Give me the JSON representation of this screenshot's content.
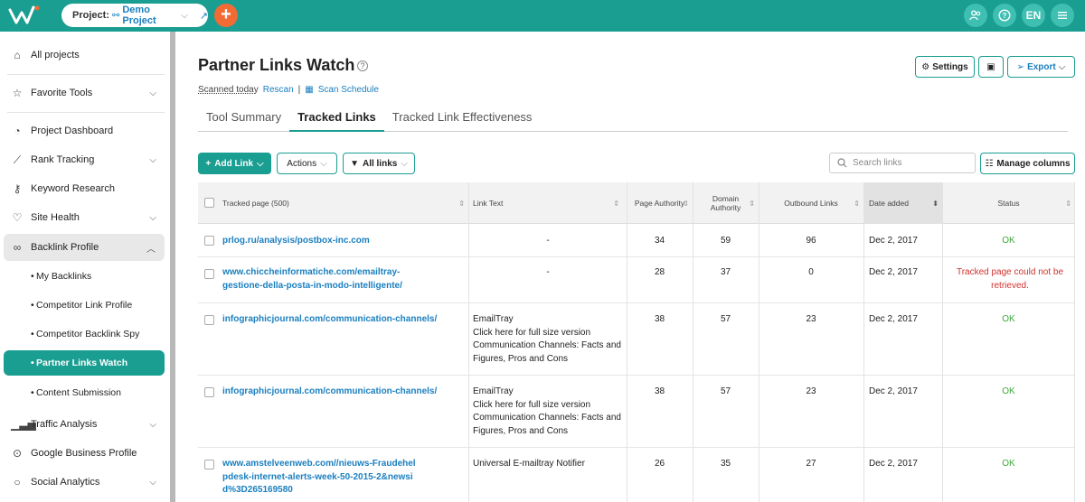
{
  "topbar": {
    "project_label": "Project:",
    "project_name": "Demo Project",
    "lang": "EN"
  },
  "sidebar": {
    "items": [
      {
        "label": "All projects",
        "icon": "home-icon"
      },
      {
        "label": "Favorite Tools",
        "icon": "star-icon"
      },
      {
        "label": "Project Dashboard",
        "icon": "dashboard-icon"
      },
      {
        "label": "Rank Tracking",
        "icon": "chart-line-icon"
      },
      {
        "label": "Keyword Research",
        "icon": "key-icon"
      },
      {
        "label": "Site Health",
        "icon": "heart-icon"
      },
      {
        "label": "Backlink Profile",
        "icon": "link-icon"
      },
      {
        "label": "Traffic Analysis",
        "icon": "bar-chart-icon"
      },
      {
        "label": "Google Business Profile",
        "icon": "location-pin-icon"
      },
      {
        "label": "Social Analytics",
        "icon": "chat-bubble-icon"
      }
    ],
    "sub_items": [
      {
        "label": "My Backlinks"
      },
      {
        "label": "Competitor Link Profile"
      },
      {
        "label": "Competitor Backlink Spy"
      },
      {
        "label": "Partner Links Watch"
      },
      {
        "label": "Content Submission"
      }
    ]
  },
  "page": {
    "title": "Partner Links Watch",
    "scanned": "Scanned today",
    "rescan": "Rescan",
    "separator": "|",
    "scan_schedule": "Scan Schedule",
    "settings": "Settings",
    "export": "Export"
  },
  "tabs": [
    {
      "label": "Tool Summary"
    },
    {
      "label": "Tracked Links"
    },
    {
      "label": "Tracked Link Effectiveness"
    }
  ],
  "toolbar": {
    "add_link": "Add Link",
    "actions": "Actions",
    "all_links": "All links",
    "search_placeholder": "Search links",
    "manage_columns": "Manage columns"
  },
  "table": {
    "headers": {
      "tracked_page": "Tracked page (500)",
      "link_text": "Link Text",
      "page_authority": "Page Authority",
      "domain_authority": "Domain Authority",
      "outbound_links": "Outbound Links",
      "date_added": "Date added",
      "status": "Status"
    },
    "rows": [
      {
        "page": "prlog.ru/analysis/postbox-inc.com",
        "link_text": "-",
        "pa": "34",
        "da": "59",
        "out": "96",
        "date": "Dec 2, 2017",
        "status": "OK",
        "status_type": "ok"
      },
      {
        "page": "www.chiccheinformatiche.com/emailtray-gestione-della-posta-in-modo-intelligente/",
        "link_text": "-",
        "pa": "28",
        "da": "37",
        "out": "0",
        "date": "Dec 2, 2017",
        "status": "Tracked page could not be retrieved.",
        "status_type": "err"
      },
      {
        "page": "infographicjournal.com/communication-channels/",
        "link_text": "EmailTray\nClick here for full size version\nCommunication Channels: Facts and Figures, Pros and Cons",
        "pa": "38",
        "da": "57",
        "out": "23",
        "date": "Dec 2, 2017",
        "status": "OK",
        "status_type": "ok"
      },
      {
        "page": "infographicjournal.com/communication-channels/",
        "link_text": "EmailTray\nClick here for full size version\nCommunication Channels: Facts and Figures, Pros and Cons",
        "pa": "38",
        "da": "57",
        "out": "23",
        "date": "Dec 2, 2017",
        "status": "OK",
        "status_type": "ok"
      },
      {
        "page": "www.amstelveenweb.com//nieuws-Fraudehelpdesk-internet-alerts-week-50-2015-2&newsid%3D265169580",
        "link_text": "Universal E-mailtray Notifier",
        "pa": "26",
        "da": "35",
        "out": "27",
        "date": "Dec 2, 2017",
        "status": "OK",
        "status_type": "ok"
      }
    ]
  },
  "colors": {
    "brand": "#1a9e91",
    "accent": "#f26b35",
    "link": "#1a7fbf",
    "ok": "#3aa83a",
    "error": "#d0312d"
  }
}
